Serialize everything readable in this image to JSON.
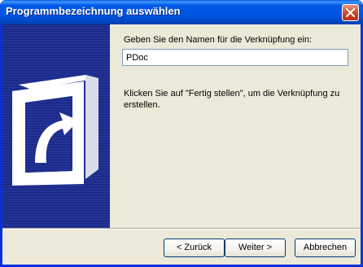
{
  "window": {
    "title": "Programmbezeichnung auswählen"
  },
  "content": {
    "prompt_label": "Geben Sie den Namen für die Verknüpfung ein:",
    "name_value": "PDoc",
    "hint": "Klicken Sie auf \"Fertig stellen\", um die Verknüpfung zu erstellen."
  },
  "buttons": {
    "back": "< Zurück",
    "next": "Weiter >",
    "cancel": "Abbrechen"
  },
  "icons": {
    "close": "close-icon",
    "shortcut_art": "shortcut-arrow-icon"
  },
  "colors": {
    "titlebar": "#0054e3",
    "side_panel": "#1b2b8a",
    "dialog_bg": "#ece9d8"
  }
}
